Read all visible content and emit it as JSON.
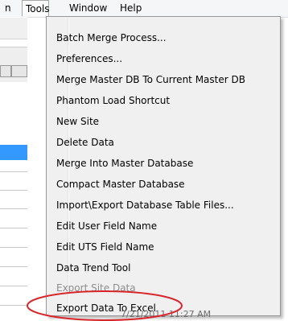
{
  "menubar": {
    "cut_item": "n",
    "tools": "Tools",
    "window": "Window",
    "help": "Help"
  },
  "tools_menu": {
    "items": [
      {
        "label": "Batch Merge Process..."
      },
      {
        "label": "Preferences..."
      },
      {
        "label": "Merge Master DB To Current Master DB"
      },
      {
        "label": "Phantom Load Shortcut"
      },
      {
        "label": "New Site"
      },
      {
        "label": "Delete Data"
      },
      {
        "label": "Merge Into Master Database"
      },
      {
        "label": "Compact Master Database"
      },
      {
        "label": "Import\\Export Database Table Files..."
      },
      {
        "label": "Edit User Field Name"
      },
      {
        "label": "Edit UTS Field Name"
      },
      {
        "label": "Data Trend Tool"
      },
      {
        "label": "Export Site Data",
        "disabled": true
      },
      {
        "label": "Export Data To Excel"
      }
    ]
  },
  "background": {
    "peek_text": "7/21/2011 11:27 AM"
  },
  "colors": {
    "annotation": "#d9262b",
    "selection": "#3399ff",
    "menu_bg": "#f0f0f0"
  }
}
